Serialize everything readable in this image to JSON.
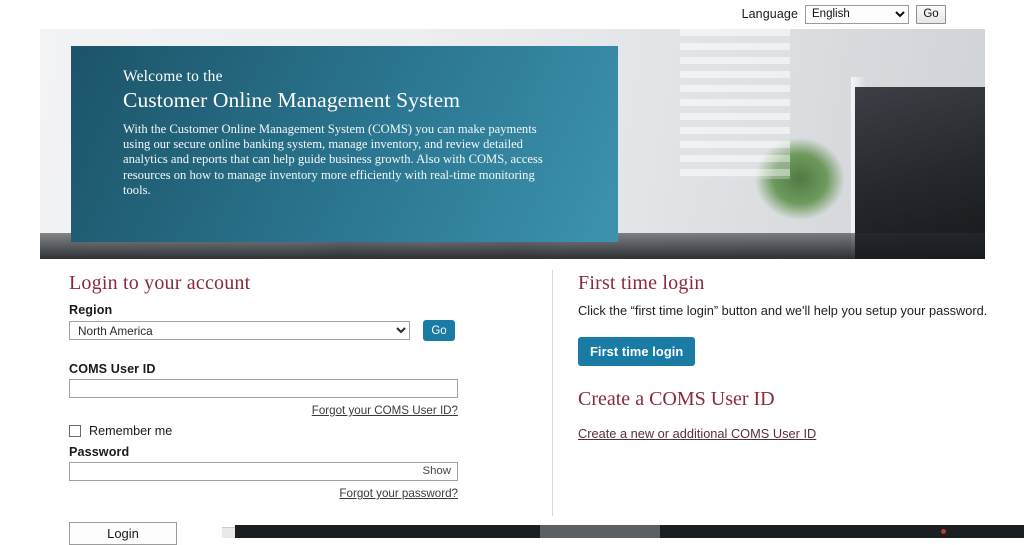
{
  "topbar": {
    "language_label": "Language",
    "language_selected": "English",
    "language_options": [
      "English"
    ],
    "go_label": "Go"
  },
  "hero": {
    "welcome": "Welcome to the",
    "title": "Customer Online Management System",
    "body": "With the Customer Online Management System (COMS) you can make payments using our secure online banking system, manage inventory, and review detailed analytics and reports that can help guide business growth. Also with COMS, access resources on how to manage inventory more efficiently with real-time monitoring tools.",
    "panel_color": "#2b7691",
    "frame_color": "#2b3034"
  },
  "login": {
    "heading": "Login to your account",
    "region_label": "Region",
    "region_selected": "North America",
    "region_options": [
      "North America"
    ],
    "region_go_label": "Go",
    "userid_label": "COMS User ID",
    "userid_value": "",
    "userid_placeholder": "",
    "forgot_userid_link": "Forgot your COMS User ID?",
    "remember_me_label": "Remember me",
    "remember_me_checked": false,
    "password_label": "Password",
    "password_value": "",
    "password_placeholder": "",
    "show_label": "Show",
    "forgot_password_link": "Forgot your password?",
    "login_button": "Login"
  },
  "first_time": {
    "heading": "First time login",
    "body": "Click the “first time login” button and we'll help you setup your password.",
    "button_label": "First time login"
  },
  "create_id": {
    "heading": "Create a COMS User ID",
    "link_label": "Create a new or additional COMS User ID"
  },
  "colors": {
    "accent_teal": "#1a7ca5",
    "heading_maroon": "#8a2a3b",
    "link_maroon": "#5a3038"
  }
}
